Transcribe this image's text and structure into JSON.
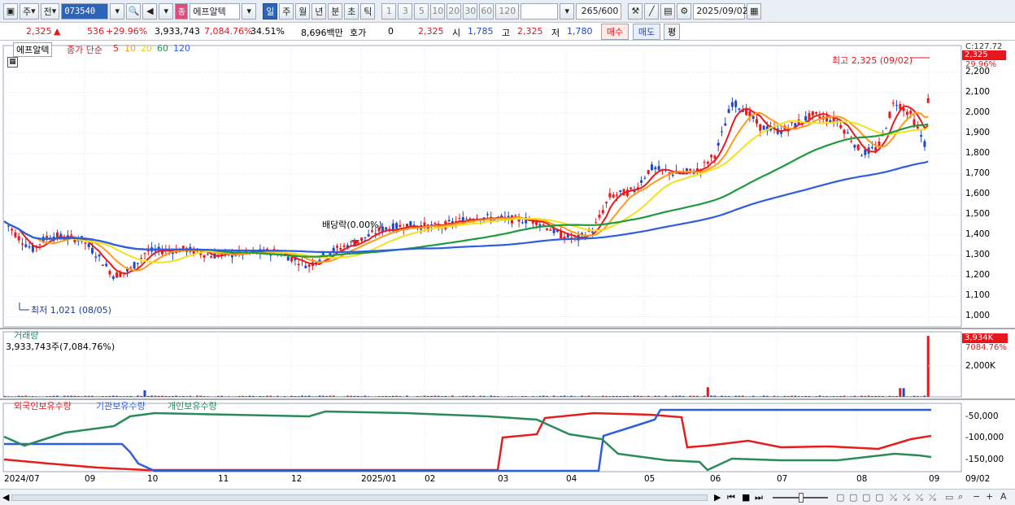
{
  "toolbar": {
    "period_type": "주",
    "market": "전",
    "stock_code": "073540",
    "stock_badge": "종",
    "stock_name": "에프알텍",
    "intervals": [
      "일",
      "주",
      "월",
      "년",
      "분",
      "초",
      "틱"
    ],
    "active_interval": "일",
    "minute_options": [
      "1",
      "3",
      "5",
      "10",
      "20",
      "30",
      "60",
      "120"
    ],
    "count": "265",
    "count_total": "/600",
    "date": "2025/09/02"
  },
  "quote": {
    "price": "2,325",
    "change": "536",
    "change_pct": "+29.96%",
    "volume": "3,933,743",
    "volume_ratio": "7,084.76%",
    "turnover": "34.51%",
    "amount": "8,696백만",
    "hoga_label": "호가",
    "hoga_value": "0",
    "hoga_price": "2,325",
    "open_label": "시",
    "open": "1,785",
    "high_label": "고",
    "high": "2,325",
    "low_label": "저",
    "low": "1,780",
    "buy_label": "매수",
    "sell_label": "매도",
    "avg_label": "평"
  },
  "price_panel": {
    "stock_label": "에프알텍",
    "ma_title": "종가 단순",
    "ma_periods": [
      "5",
      "10",
      "20",
      "60",
      "120"
    ],
    "ma_colors": [
      "#e51d1d",
      "#ff9a1c",
      "#f2e21c",
      "#1f9a3c",
      "#2f5de0"
    ],
    "high_note": "최고 2,325 (09/02)",
    "low_note": "최저 1,021 (08/05)",
    "dividend_note": "배당락(0.00%)",
    "top_label": "C:127.72",
    "price_tag": "2,325",
    "pct_tag": "29.96%",
    "y_ticks": [
      "2,200",
      "2,100",
      "2,000",
      "1,900",
      "1,800",
      "1,700",
      "1,600",
      "1,500",
      "1,400",
      "1,300",
      "1,200",
      "1,100",
      "1,000"
    ]
  },
  "volume_panel": {
    "title": "거래량",
    "value_text": "3,933,743주(7,084.76%)",
    "tag": "3,934K",
    "tag_pct": "7084.76%",
    "y_tick": "2,000K"
  },
  "holding_panel": {
    "series": [
      "외국인보유수량",
      "기관보유수량",
      "개인보유수량"
    ],
    "series_colors": [
      "#e51d1d",
      "#2f5de0",
      "#2b8a5a"
    ],
    "y_ticks": [
      "-50,000",
      "-100,000",
      "-150,000"
    ]
  },
  "x_axis": {
    "labels": [
      "2024/07",
      "09",
      "10",
      "11",
      "12",
      "2025/01",
      "02",
      "03",
      "04",
      "05",
      "06",
      "07",
      "08",
      "09",
      "09/02"
    ]
  },
  "colors": {
    "up": "#e8161d",
    "down": "#1f49c8",
    "accent": "#2d64b8"
  }
}
